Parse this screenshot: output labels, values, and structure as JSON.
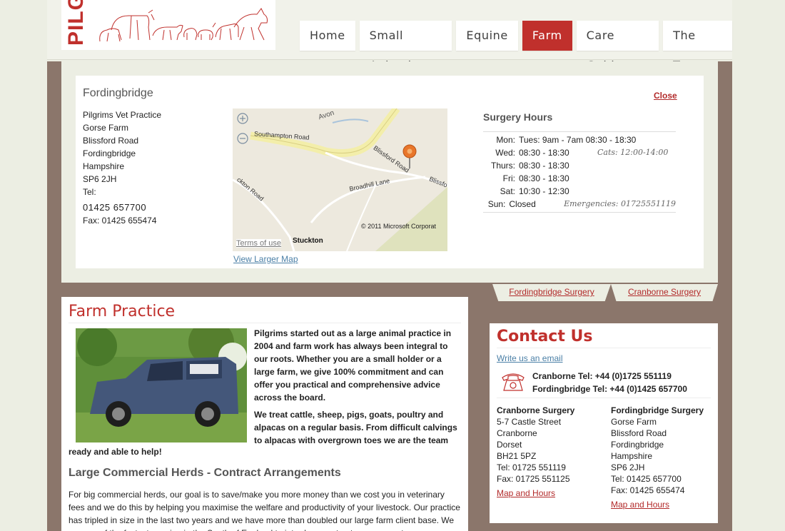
{
  "header": {
    "logo_text": "PILGR",
    "nav": [
      "Home",
      "Small Animals",
      "Equine",
      "Farm",
      "Care Guides",
      "The Team"
    ],
    "active": "Farm"
  },
  "location": {
    "title": "Fordingbridge",
    "close_label": "Close",
    "address_lines": [
      "Pilgrims Vet Practice",
      "Gorse Farm",
      "Blissford Road",
      "Fordingbridge",
      "Hampshire",
      "SP6 2JH",
      "Tel:"
    ],
    "phone": "01425 657700",
    "fax": "Fax: 01425 655474",
    "map": {
      "labels": {
        "avon": "Avon",
        "southampton_road": "Southampton Road",
        "blissford_road": "Blissford Road",
        "broadhill_lane": "Broadhill Lane",
        "blissford": "Blissfo",
        "stuckton_road": "ckton Road",
        "copyright": "© 2011 Microsoft Corporat",
        "terms": "Terms of use",
        "stuckton": "Stuckton"
      }
    },
    "view_larger": "View Larger Map",
    "hours_title": "Surgery Hours",
    "hours": [
      {
        "day": "Mon:",
        "times": "Tues:  9am - 7am 08:30 - 18:30",
        "note": ""
      },
      {
        "day": "Wed:",
        "times": "08:30 - 18:30",
        "note": "Cats: 12:00-14:00"
      },
      {
        "day": "Thurs:",
        "times": "08:30 - 18:30",
        "note": ""
      },
      {
        "day": "Fri:",
        "times": "08:30 - 18:30",
        "note": ""
      },
      {
        "day": "Sat:",
        "times": " 10:30 - 12:30",
        "note": ""
      },
      {
        "day": "Sun:",
        "times": "Closed",
        "note": "Emergencies: 01725551119"
      }
    ]
  },
  "tabs": [
    "Fordingbridge Surgery",
    "Cranborne Surgery"
  ],
  "farm": {
    "title": "Farm Practice",
    "intro_1": "Pilgrims started out as a large animal practice in 2004 and farm work has always been integral to our roots. Whether you are a small holder or a large farm, we give 100% commitment and can offer you practical and comprehensive advice across the board.",
    "intro_2": "We treat cattle, sheep, pigs, goats, poultry and alpacas on a regular basis.  From difficult calvings to alpacas with overgrown toes we are the team",
    "intro_cont": "ready and able to help!",
    "subhead": "Large Commercial Herds - Contract Arrangements",
    "body": "For big commercial herds, our goal is to save/make you more money than we cost you in veterinary fees and we do this by helping you maximise the welfare and productivity of your livestock. Our practice has tripled in size in the last two years and we have more than doubled our large farm client base. We are one of the fastest growing in the South of England to introduce contract arrangements"
  },
  "contact": {
    "title": "Contact Us",
    "email_link": "Write us an email",
    "tel_cranborne": "Cranborne Tel: +44 (0)1725 551119",
    "tel_fordingbridge": "Fordingbridge Tel: +44 (0)1425 657700",
    "cranborne": {
      "name": "Cranborne Surgery",
      "lines": [
        "5-7 Castle Street",
        "Cranborne",
        "Dorset",
        "BH21 5PZ",
        "Tel: 01725 551119",
        "Fax: 01725 551125"
      ],
      "link": "Map and Hours"
    },
    "fordingbridge": {
      "name": "Fordingbridge Surgery",
      "lines": [
        "Gorse Farm",
        "Blissford Road",
        "Fordingbridge",
        "Hampshire",
        "SP6 2JH",
        "Tel: 01425 657700",
        "Fax: 01425 655474"
      ],
      "link": "Map and Hours"
    }
  },
  "colors": {
    "brand_red": "#c0302c",
    "brown": "#8b766b",
    "cream": "#eceee3",
    "link_blue": "#4a7fa6"
  }
}
